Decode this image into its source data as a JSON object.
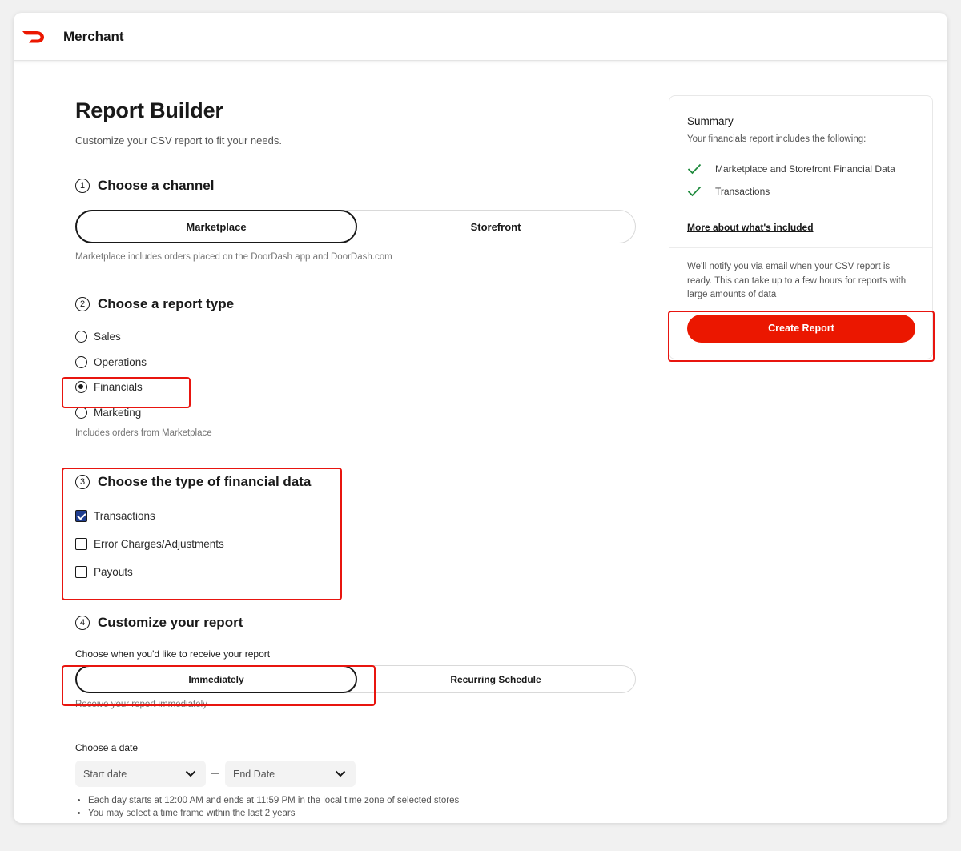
{
  "app": {
    "brand": "Merchant",
    "brand_color": "#eb1700"
  },
  "page": {
    "title": "Report Builder",
    "subtitle": "Customize your CSV report to fit your needs."
  },
  "channel": {
    "number": "1",
    "title": "Choose a channel",
    "options": [
      "Marketplace",
      "Storefront"
    ],
    "selected": "Marketplace",
    "help": "Marketplace includes orders placed on the DoorDash app and DoorDash.com"
  },
  "report_type": {
    "number": "2",
    "title": "Choose a report type",
    "options": [
      "Sales",
      "Operations",
      "Financials",
      "Marketing"
    ],
    "selected": "Financials",
    "help": "Includes orders from Marketplace"
  },
  "financial_data": {
    "number": "3",
    "title": "Choose the type of financial data",
    "options": [
      {
        "label": "Transactions",
        "checked": true
      },
      {
        "label": "Error Charges/Adjustments",
        "checked": false
      },
      {
        "label": "Payouts",
        "checked": false
      }
    ]
  },
  "customize": {
    "number": "4",
    "title": "Customize your report",
    "receive_label": "Choose when you'd like to receive your report",
    "receive_options": [
      "Immediately",
      "Recurring Schedule"
    ],
    "receive_selected": "Immediately",
    "receive_help": "Receive your report immediately",
    "date_label": "Choose a date",
    "start_placeholder": "Start date",
    "end_placeholder": "End Date",
    "notes": [
      "Each day starts at 12:00 AM and ends at 11:59 PM in the local time zone of selected stores",
      "You may select a time frame within the last 2 years"
    ]
  },
  "summary": {
    "title": "Summary",
    "subtitle": "Your financials report includes the following:",
    "items": [
      "Marketplace and Storefront Financial Data",
      "Transactions"
    ],
    "more_link": "More about what's included",
    "notify": "We'll notify you via email when your CSV report is ready. This can take up to a few hours for reports with large amounts of data",
    "button": "Create Report"
  }
}
